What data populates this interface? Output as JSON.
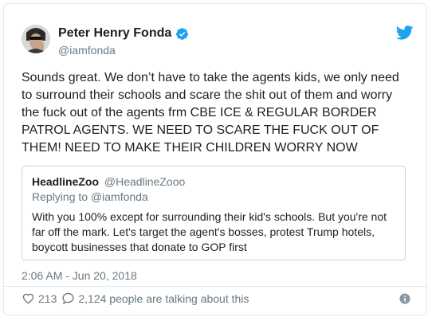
{
  "tweet": {
    "author": {
      "display_name": "Peter Henry Fonda",
      "handle": "@iamfonda",
      "verified": true,
      "avatar_icon": "user-avatar"
    },
    "text": "Sounds great. We don’t have to take the agents kids, we only need to surround their schools and scare the shit out of them and worry the fuck out of the agents frm CBE ICE & REGULAR BORDER PATROL AGENTS. WE NEED TO SCARE THE FUCK OUT OF THEM! NEED TO MAKE THEIR CHILDREN WORRY NOW",
    "quoted": {
      "display_name": "HeadlineZoo",
      "handle": "@HeadlineZooo",
      "reply_prefix": "Replying to",
      "reply_to": "@iamfonda",
      "text": "With you 100% except for surrounding their kid's schools. But you're not far off the mark. Let's target the agent's bosses, protest Trump hotels, boycott businesses that donate to GOP first"
    },
    "timestamp": "2:06 AM - Jun 20, 2018",
    "likes": "213",
    "talking_text": "2,124 people are talking about this"
  },
  "colors": {
    "twitter_blue": "#1da1f2",
    "secondary_text": "#697882",
    "primary_text": "#1c2022",
    "border": "#e1e8ed"
  }
}
